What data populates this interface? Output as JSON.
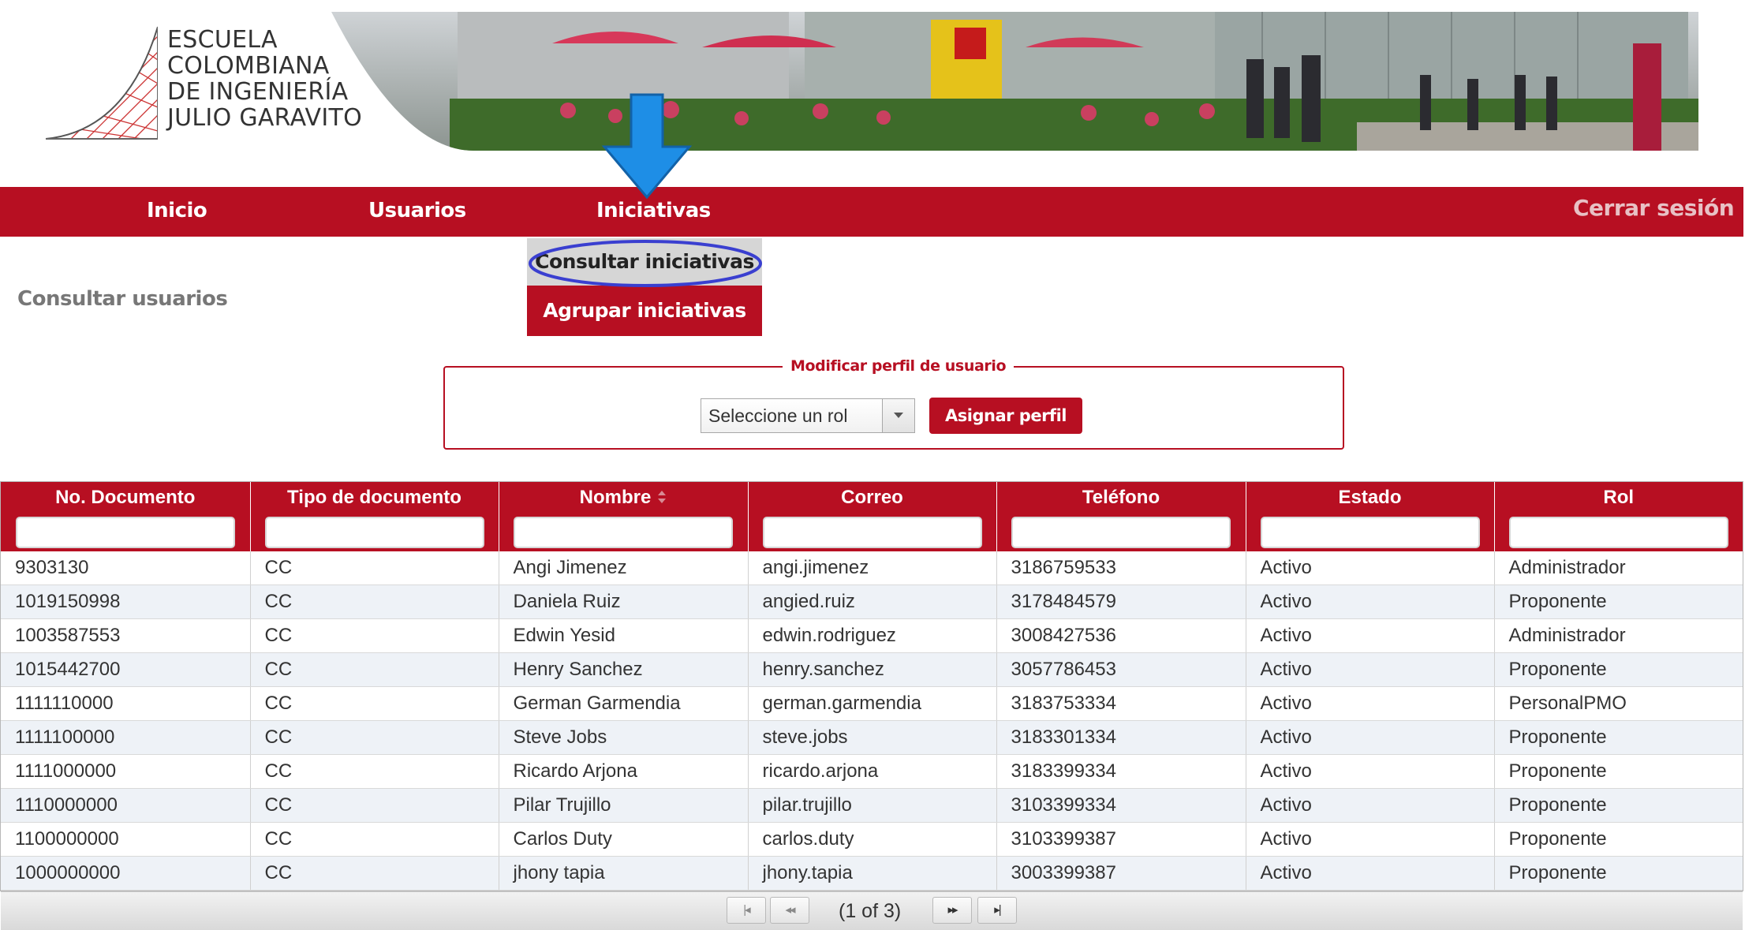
{
  "logo": {
    "lines": [
      "ESCUELA",
      "COLOMBIANA",
      "DE INGENIERÍA",
      "JULIO GARAVITO"
    ]
  },
  "nav": {
    "items": [
      "Inicio",
      "Usuarios",
      "Iniciativas"
    ],
    "logout": "Cerrar sesión"
  },
  "dropdown": {
    "items": [
      "Consultar iniciativas",
      "Agrupar iniciativas"
    ]
  },
  "page": {
    "title": "Consultar usuarios"
  },
  "profile_form": {
    "legend": "Modificar perfil de usuario",
    "select_value": "Seleccione un rol",
    "assign_button": "Asignar perfil"
  },
  "table": {
    "columns": [
      "No. Documento",
      "Tipo de documento",
      "Nombre",
      "Correo",
      "Teléfono",
      "Estado",
      "Rol"
    ],
    "rows": [
      [
        "9303130",
        "CC",
        "Angi Jimenez",
        "angi.jimenez",
        "3186759533",
        "Activo",
        "Administrador"
      ],
      [
        "1019150998",
        "CC",
        "Daniela Ruiz",
        "angied.ruiz",
        "3178484579",
        "Activo",
        "Proponente"
      ],
      [
        "1003587553",
        "CC",
        "Edwin Yesid",
        "edwin.rodriguez",
        "3008427536",
        "Activo",
        "Administrador"
      ],
      [
        "1015442700",
        "CC",
        "Henry Sanchez",
        "henry.sanchez",
        "3057786453",
        "Activo",
        "Proponente"
      ],
      [
        "1111110000",
        "CC",
        "German Garmendia",
        "german.garmendia",
        "3183753334",
        "Activo",
        "PersonalPMO"
      ],
      [
        "1111100000",
        "CC",
        "Steve Jobs",
        "steve.jobs",
        "3183301334",
        "Activo",
        "Proponente"
      ],
      [
        "1111000000",
        "CC",
        "Ricardo Arjona",
        "ricardo.arjona",
        "3183399334",
        "Activo",
        "Proponente"
      ],
      [
        "1110000000",
        "CC",
        "Pilar Trujillo",
        "pilar.trujillo",
        "3103399334",
        "Activo",
        "Proponente"
      ],
      [
        "1100000000",
        "CC",
        "Carlos Duty",
        "carlos.duty",
        "3103399387",
        "Activo",
        "Proponente"
      ],
      [
        "1000000000",
        "CC",
        "jhony tapia",
        "jhony.tapia",
        "3003399387",
        "Activo",
        "Proponente"
      ]
    ]
  },
  "paginator": {
    "text": "(1 of 3)",
    "buttons": [
      "first-page-icon",
      "prev-page-icon",
      "next-page-icon",
      "last-page-icon"
    ]
  },
  "colors": {
    "brand_red": "#b70f22",
    "arrow_blue": "#1e8ee6",
    "highlight_ellipse": "#3a3fd0"
  }
}
